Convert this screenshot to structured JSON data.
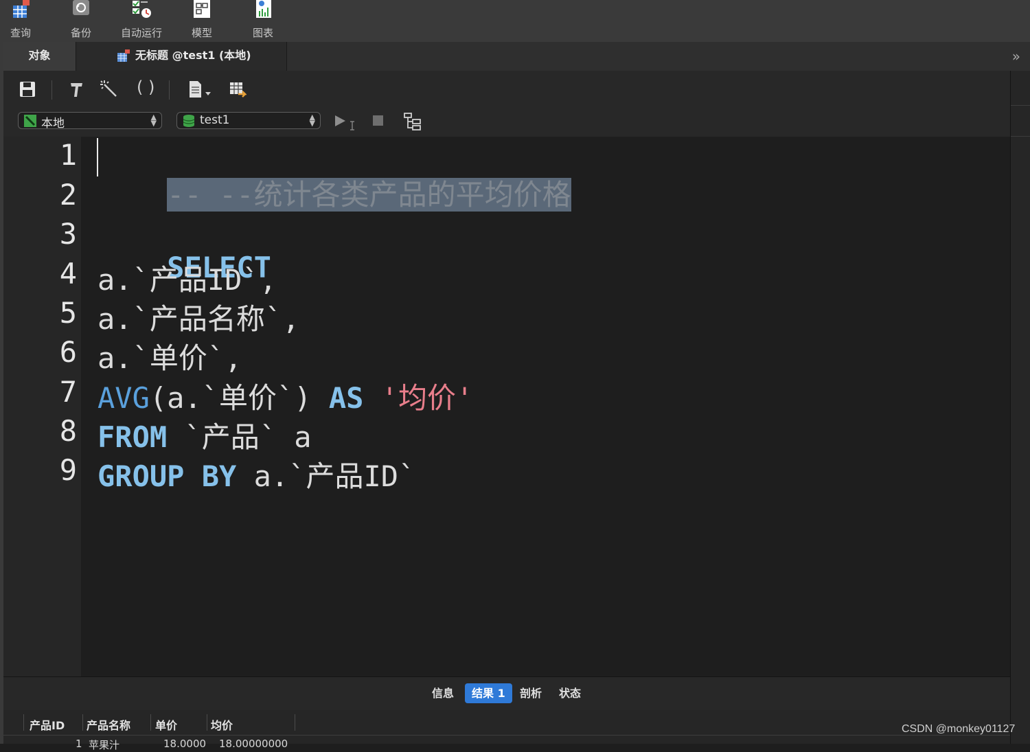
{
  "toolbar": {
    "items": [
      {
        "label": "查询",
        "icon": "query-table-icon"
      },
      {
        "label": "备份",
        "icon": "backup-icon"
      },
      {
        "label": "自动运行",
        "icon": "auto-run-icon"
      },
      {
        "label": "模型",
        "icon": "model-icon"
      },
      {
        "label": "图表",
        "icon": "chart-icon"
      }
    ]
  },
  "tabs": {
    "objects": "对象",
    "query": "无标题 @test1 (本地)",
    "more": "»"
  },
  "connection": {
    "server": "本地",
    "database": "test1"
  },
  "editor": {
    "line_numbers": [
      "1",
      "2",
      "3",
      "4",
      "5",
      "6",
      "7",
      "8",
      "9"
    ],
    "lines": {
      "l1": "-- --统计各类产品的平均价格",
      "l3_kw": "SELECT",
      "l4": "a.`产品ID`,",
      "l5": "a.`产品名称`,",
      "l6": "a.`单价`,",
      "l7_fn": "AVG",
      "l7_mid": "(a.`单价`) ",
      "l7_kw": "AS",
      "l7_str": "'均价'",
      "l8_kw": "FROM",
      "l8_rest": " `产品` a",
      "l9_kw": "GROUP BY",
      "l9_rest": " a.`产品ID`"
    }
  },
  "results": {
    "tabs": [
      "信息",
      "结果 1",
      "剖析",
      "状态"
    ],
    "active_tab": "结果 1",
    "columns": [
      "产品ID",
      "产品名称",
      "单价",
      "均价"
    ],
    "first_row_partial": [
      "1",
      "苹果汁",
      "18.0000",
      "18.00000000"
    ]
  },
  "watermark": "CSDN @monkey01127",
  "colors": {
    "accent": "#2f7ad8",
    "keyword": "#86c1ea",
    "function": "#5aa0dc",
    "string": "#e87e8b",
    "comment_selection": "#5a6878"
  }
}
